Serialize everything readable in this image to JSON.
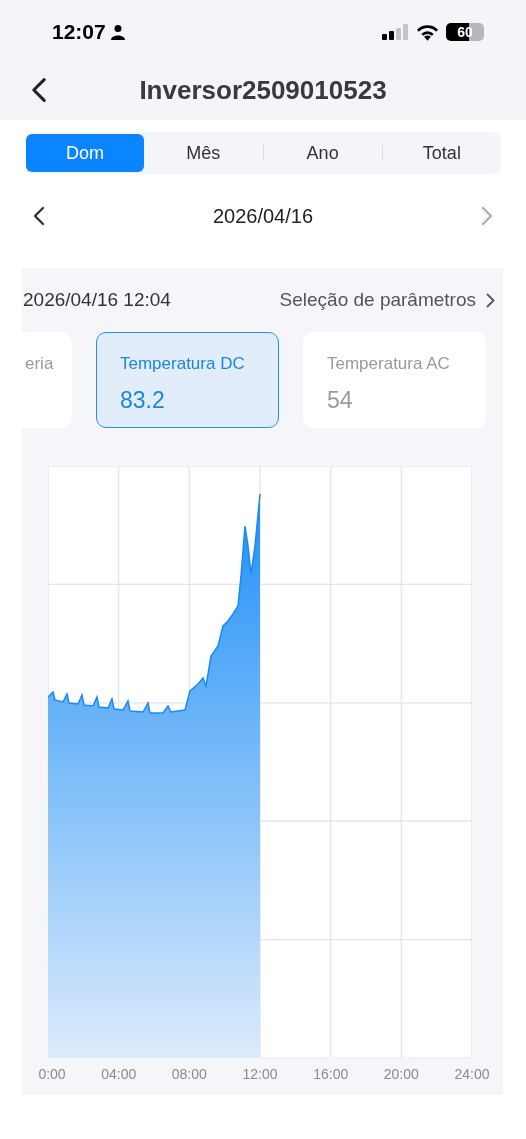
{
  "status_bar": {
    "time": "12:07",
    "battery": "60"
  },
  "header": {
    "title": "Inversor2509010523"
  },
  "tabs": [
    {
      "label": "Dom",
      "selected": true
    },
    {
      "label": "Mês",
      "selected": false
    },
    {
      "label": "Ano",
      "selected": false
    },
    {
      "label": "Total",
      "selected": false
    }
  ],
  "date_nav": {
    "date": "2026/04/16",
    "next_disabled": true
  },
  "panel": {
    "timestamp": "2026/04/16 12:04",
    "parameter_link": "Seleção de parâmetros",
    "cards": [
      {
        "label": "eria",
        "selected": false
      },
      {
        "label": "Temperatura DC",
        "value": "83.2",
        "selected": true
      },
      {
        "label": "Temperatura AC",
        "value": "54",
        "selected": false
      }
    ],
    "chart": {
      "x_labels": [
        "0:00",
        "04:00",
        "08:00",
        "12:00",
        "16:00",
        "20:00",
        "24:00"
      ]
    }
  }
}
